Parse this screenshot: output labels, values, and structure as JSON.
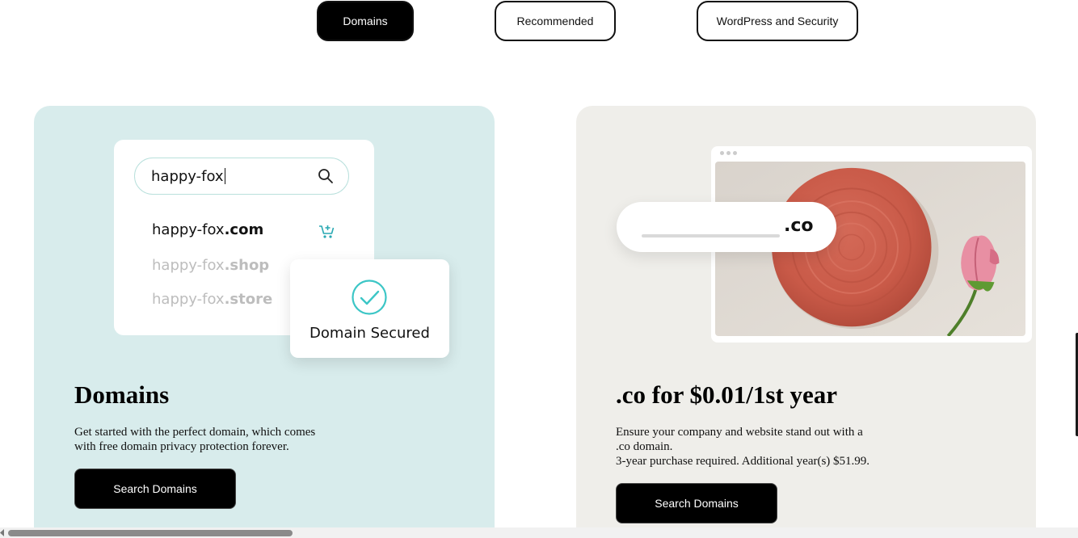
{
  "tabs": [
    {
      "label": "Domains",
      "active": true
    },
    {
      "label": "Recommended",
      "active": false
    },
    {
      "label": "WordPress and Security",
      "active": false
    }
  ],
  "domains_card": {
    "illustration": {
      "search_value": "happy-fox",
      "results": [
        {
          "name": "happy-fox",
          "tld": ".com",
          "state": "available"
        },
        {
          "name": "happy-fox",
          "tld": ".shop",
          "state": "muted"
        },
        {
          "name": "happy-fox",
          "tld": ".store",
          "state": "muted"
        }
      ],
      "secured_label": "Domain Secured"
    },
    "title": "Domains",
    "description_line1": "Get started with the perfect domain, which comes",
    "description_line2": "with free domain privacy protection forever.",
    "button_label": "Search Domains"
  },
  "co_card": {
    "illustration": {
      "tld": ".co"
    },
    "title": ".co for $0.01/1st year",
    "description_line1": "Ensure your company and website stand out with a",
    "description_line2": ".co domain.",
    "description_line3": "3-year purchase required. Additional year(s) $51.99.",
    "button_label": "Search Domains"
  },
  "colors": {
    "domains_card_bg": "#d8ecec",
    "co_card_bg": "#efeeea",
    "accent_teal": "#3cc6c6",
    "button_bg": "#000000"
  },
  "icons": [
    "search-icon",
    "add-to-cart-icon",
    "check-circle-icon"
  ]
}
